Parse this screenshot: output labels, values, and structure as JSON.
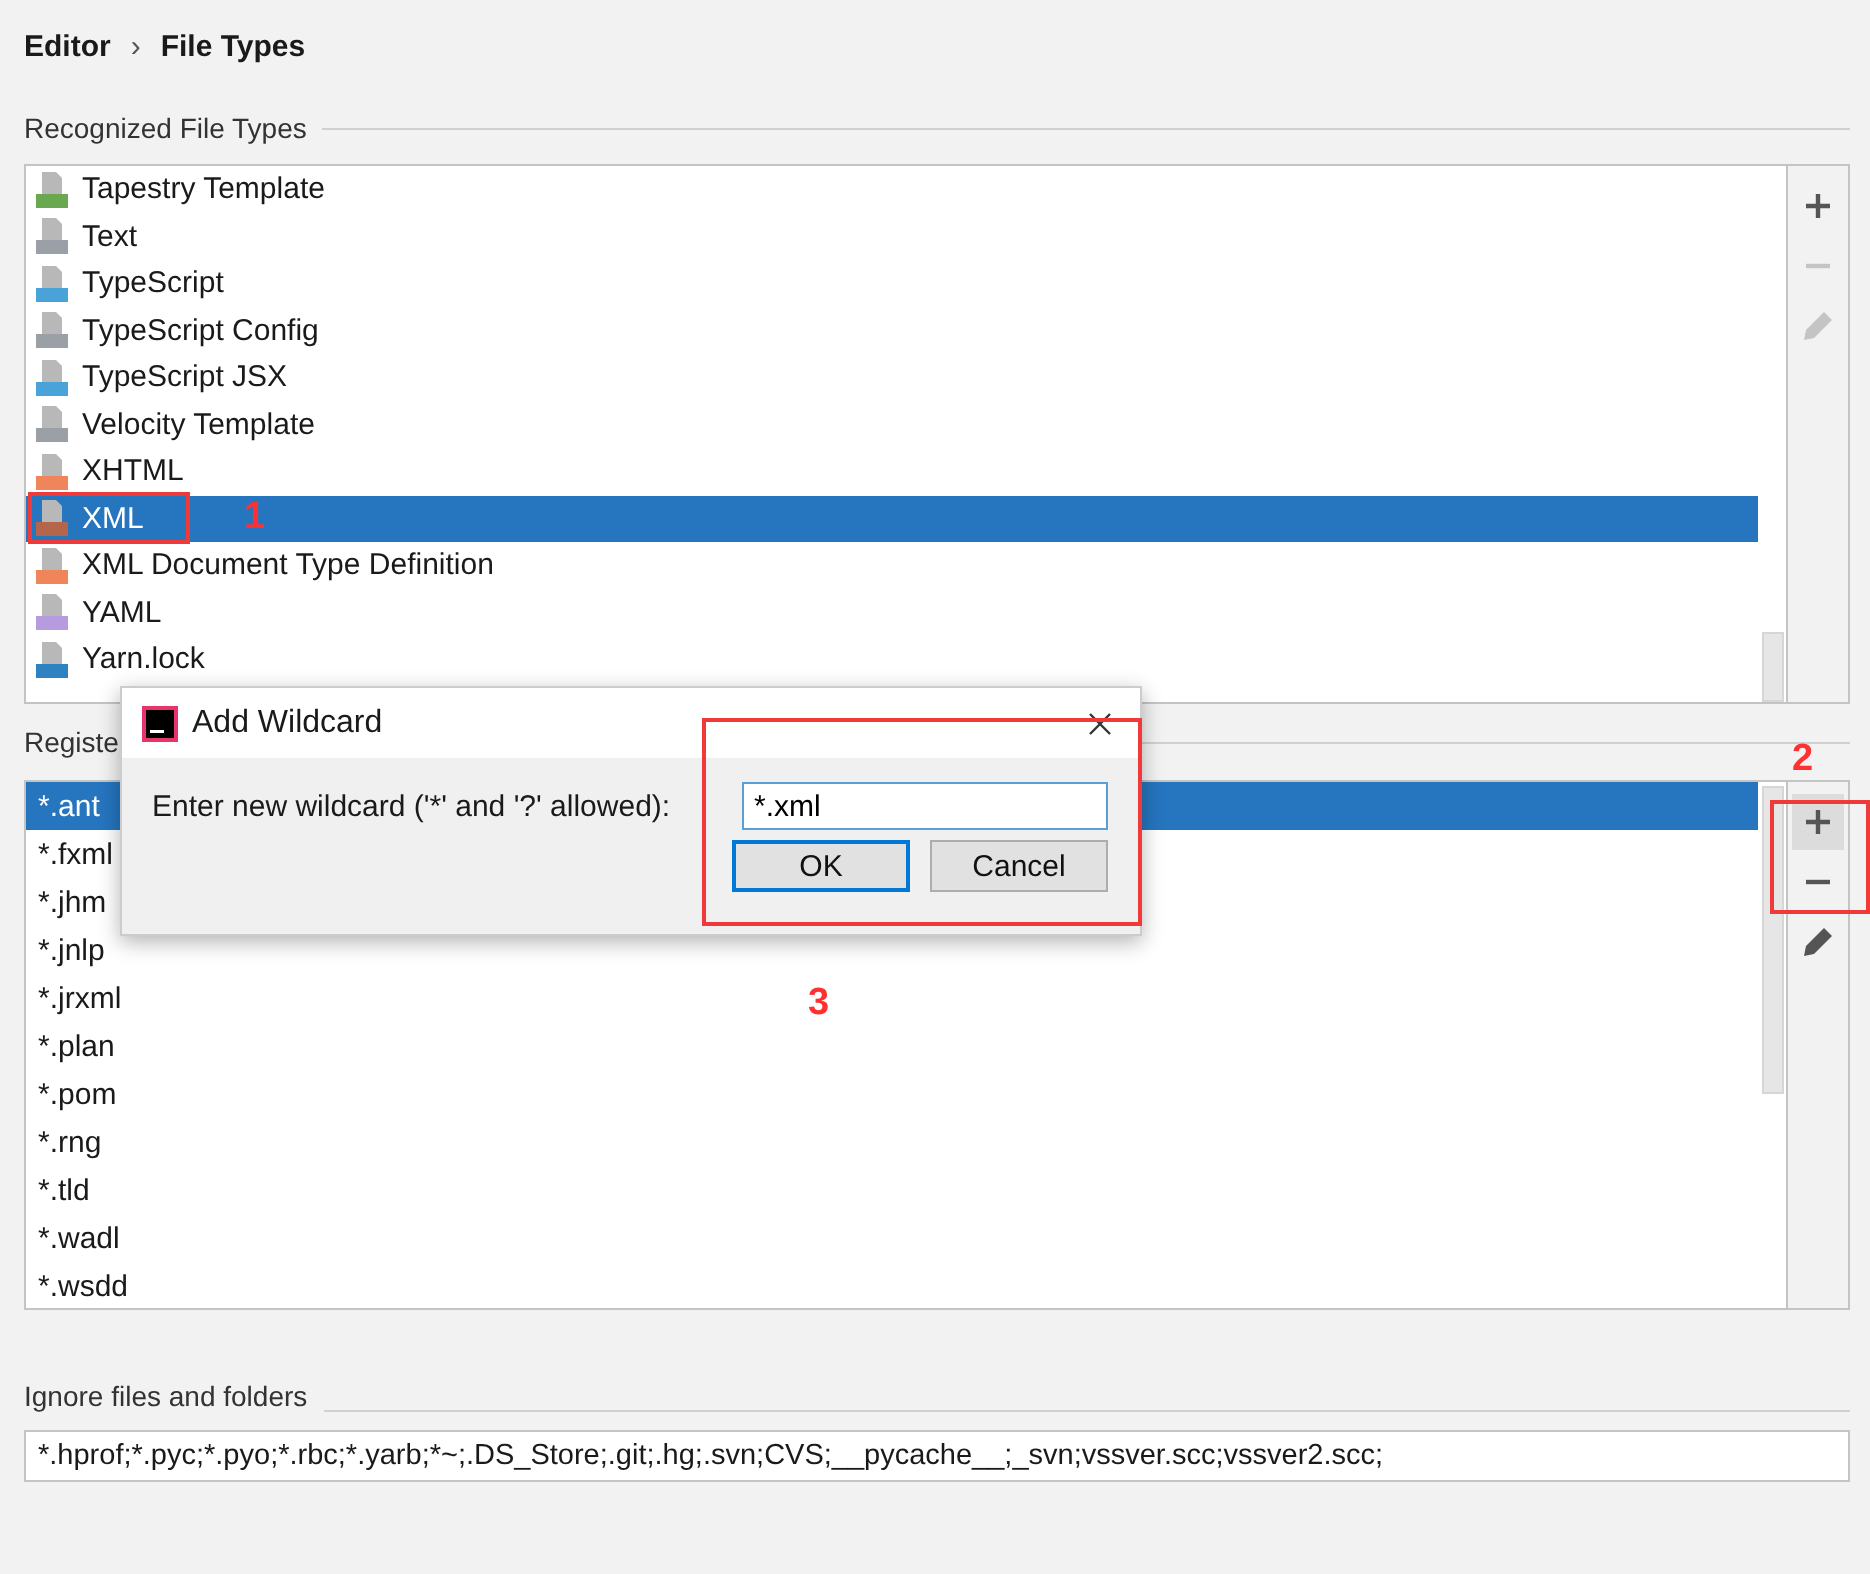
{
  "breadcrumb": [
    "Editor",
    "›",
    "File Types"
  ],
  "recognized": {
    "label": "Recognized File Types",
    "items": [
      {
        "name": "Tapestry Template",
        "color": "#6aa84f",
        "selected": false
      },
      {
        "name": "Text",
        "color": "#9aa0a6",
        "selected": false
      },
      {
        "name": "TypeScript",
        "color": "#4aa3d8",
        "selected": false
      },
      {
        "name": "TypeScript Config",
        "color": "#9aa0a6",
        "selected": false
      },
      {
        "name": "TypeScript JSX",
        "color": "#4aa3d8",
        "selected": false
      },
      {
        "name": "Velocity Template",
        "color": "#9aa0a6",
        "selected": false
      },
      {
        "name": "XHTML",
        "color": "#f0845a",
        "selected": false
      },
      {
        "name": "XML",
        "color": "#b5654a",
        "selected": true
      },
      {
        "name": "XML Document Type Definition",
        "color": "#f0845a",
        "selected": false
      },
      {
        "name": "YAML",
        "color": "#b79be0",
        "selected": false
      },
      {
        "name": "Yarn.lock",
        "color": "#2f82c0",
        "selected": false
      }
    ],
    "tools": [
      {
        "kind": "add",
        "disabled": false,
        "highlighted": false
      },
      {
        "kind": "remove",
        "disabled": true,
        "highlighted": false
      },
      {
        "kind": "edit",
        "disabled": true,
        "highlighted": false
      }
    ]
  },
  "patterns": {
    "label": "Registe",
    "items": [
      {
        "name": "*.ant",
        "selected": true
      },
      {
        "name": "*.fxml",
        "selected": false
      },
      {
        "name": "*.jhm",
        "selected": false
      },
      {
        "name": "*.jnlp",
        "selected": false
      },
      {
        "name": "*.jrxml",
        "selected": false
      },
      {
        "name": "*.plan",
        "selected": false
      },
      {
        "name": "*.pom",
        "selected": false
      },
      {
        "name": "*.rng",
        "selected": false
      },
      {
        "name": "*.tld",
        "selected": false
      },
      {
        "name": "*.wadl",
        "selected": false
      },
      {
        "name": "*.wsdd",
        "selected": false
      }
    ],
    "tools": [
      {
        "kind": "add",
        "disabled": false,
        "highlighted": true
      },
      {
        "kind": "remove",
        "disabled": false,
        "highlighted": false
      },
      {
        "kind": "edit",
        "disabled": false,
        "highlighted": false
      }
    ]
  },
  "ignore": {
    "label": "Ignore files and folders",
    "value": "*.hprof;*.pyc;*.pyo;*.rbc;*.yarb;*~;.DS_Store;.git;.hg;.svn;CVS;__pycache__;_svn;vssver.scc;vssver2.scc;"
  },
  "dialog": {
    "title": "Add Wildcard",
    "prompt": "Enter new wildcard ('*' and '?' allowed):",
    "value": "*.xml",
    "buttons": [
      {
        "label": "OK",
        "default": true
      },
      {
        "label": "Cancel",
        "default": false
      }
    ]
  },
  "annotations": [
    {
      "label": "1"
    },
    {
      "label": "2"
    },
    {
      "label": "3"
    }
  ]
}
